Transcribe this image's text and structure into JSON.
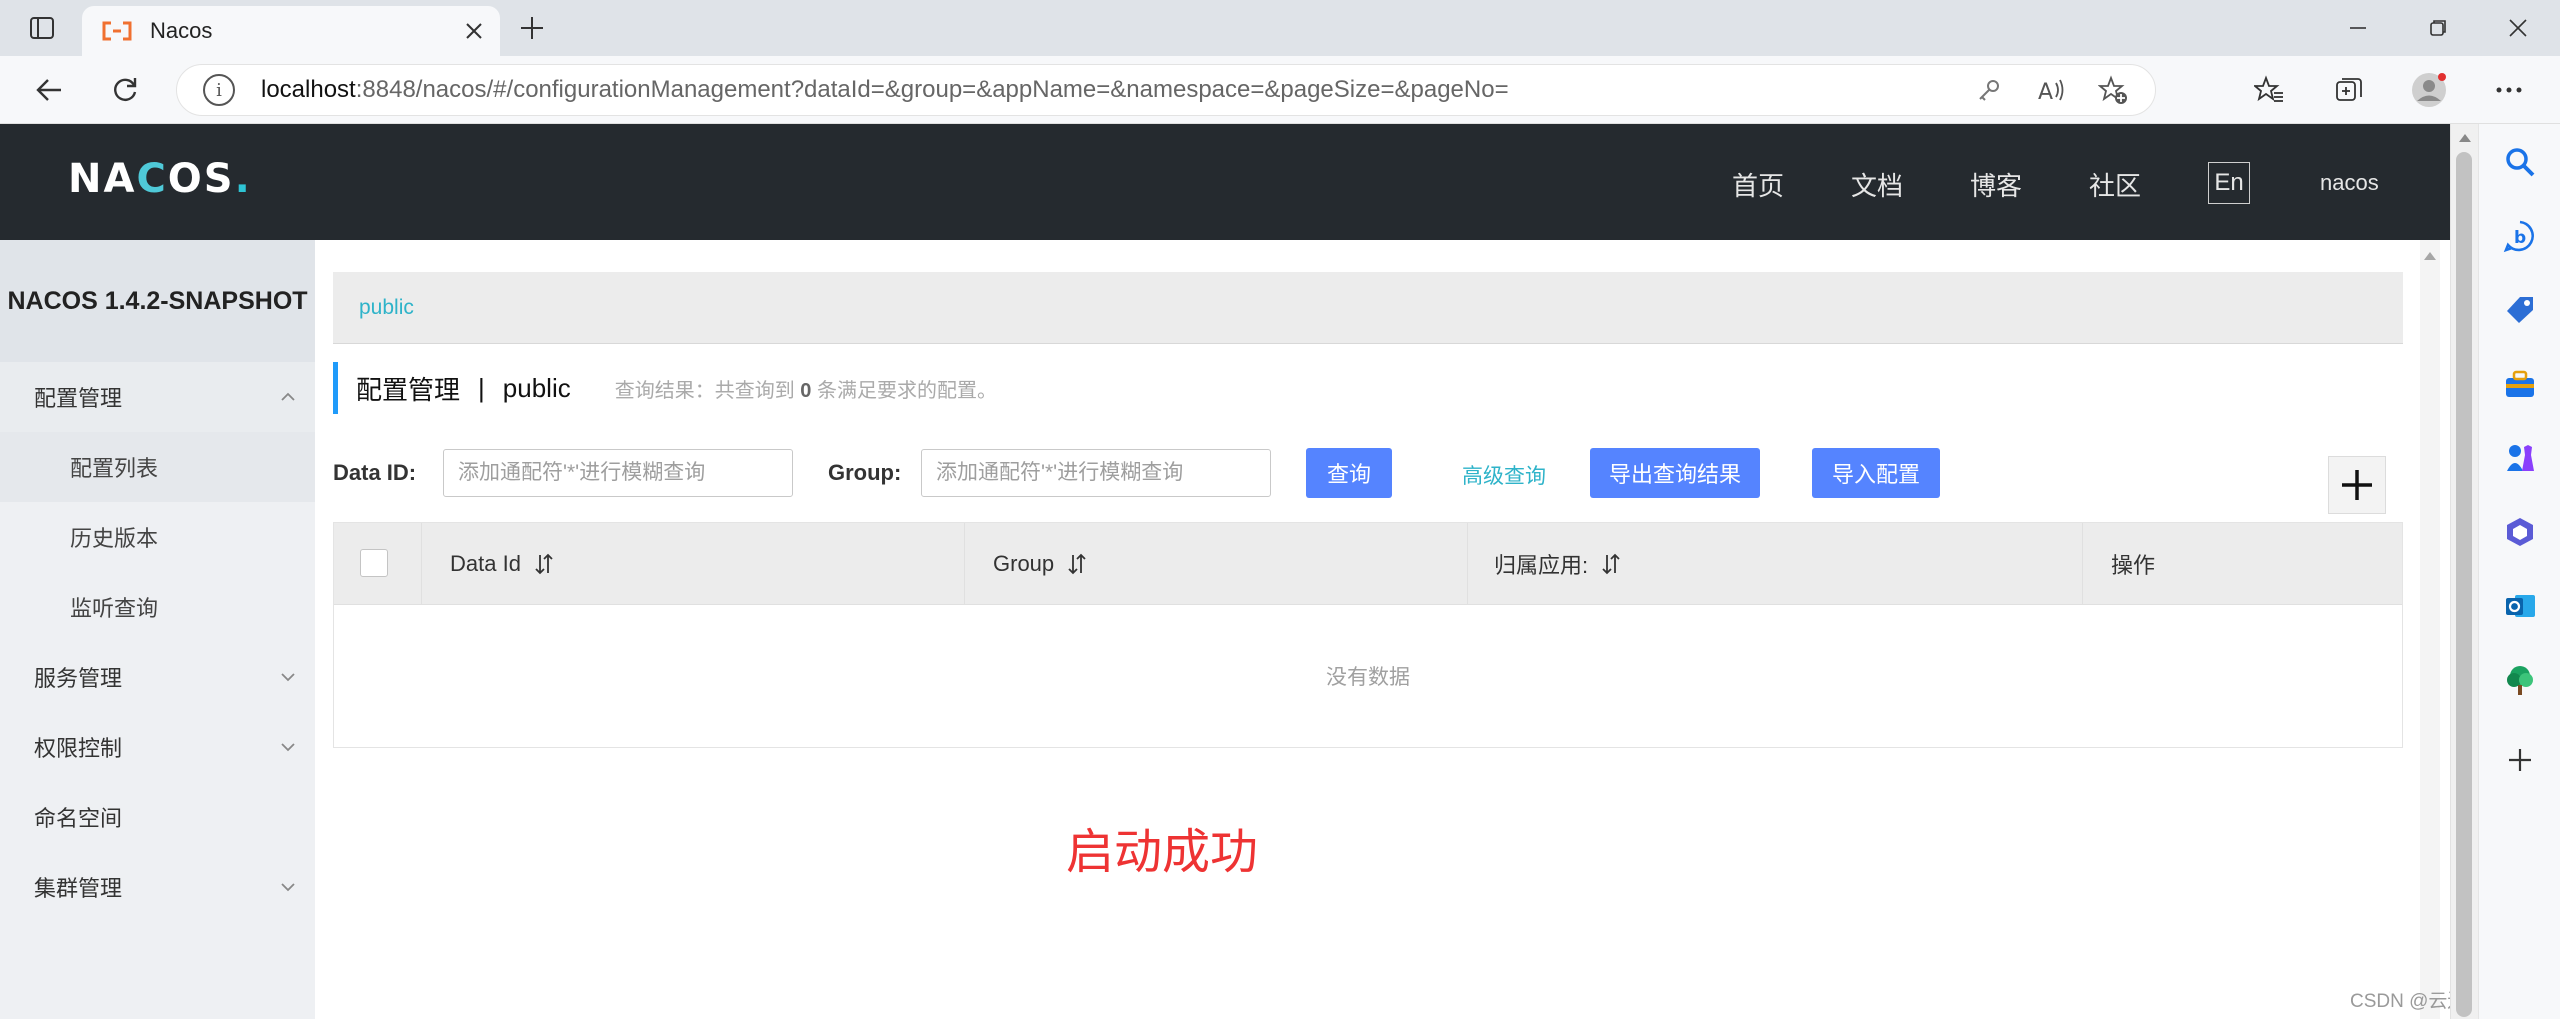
{
  "browser": {
    "tab_title": "Nacos",
    "url_host": "localhost",
    "url_rest": ":8848/nacos/#/configurationManagement?dataId=&group=&appName=&namespace=&pageSize=&pageNo="
  },
  "header": {
    "logo": {
      "part1": "NA",
      "part2": "C",
      "part3": "OS",
      "dot": "."
    },
    "nav": [
      "首页",
      "文档",
      "博客",
      "社区"
    ],
    "lang": "En",
    "user": "nacos"
  },
  "sidebar": {
    "version": "NACOS 1.4.2-SNAPSHOT",
    "items": [
      {
        "label": "配置管理"
      },
      {
        "label": "配置列表"
      },
      {
        "label": "历史版本"
      },
      {
        "label": "监听查询"
      },
      {
        "label": "服务管理"
      },
      {
        "label": "权限控制"
      },
      {
        "label": "命名空间"
      },
      {
        "label": "集群管理"
      }
    ]
  },
  "main": {
    "namespace_tab": "public",
    "title": "配置管理",
    "title_sep": "|",
    "title_ns": "public",
    "result_prefix": "查询结果：共查询到",
    "result_count": "0",
    "result_suffix": "条满足要求的配置。",
    "filters": {
      "dataid_label": "Data ID:",
      "dataid_placeholder": "添加通配符'*'进行模糊查询",
      "group_label": "Group:",
      "group_placeholder": "添加通配符'*'进行模糊查询"
    },
    "buttons": {
      "query": "查询",
      "advanced": "高级查询",
      "export": "导出查询结果",
      "import": "导入配置"
    },
    "table": {
      "columns": [
        "Data Id",
        "Group",
        "归属应用:",
        "操作"
      ],
      "empty": "没有数据"
    },
    "overlay_text": "启动成功",
    "watermark": "CSDN @云边的快乐猫"
  },
  "colors": {
    "header_bg": "#252a2f",
    "primary": "#5584ff",
    "link": "#2eb3c9",
    "accent_bar": "#209bfa",
    "success_text": "#ee3333"
  }
}
